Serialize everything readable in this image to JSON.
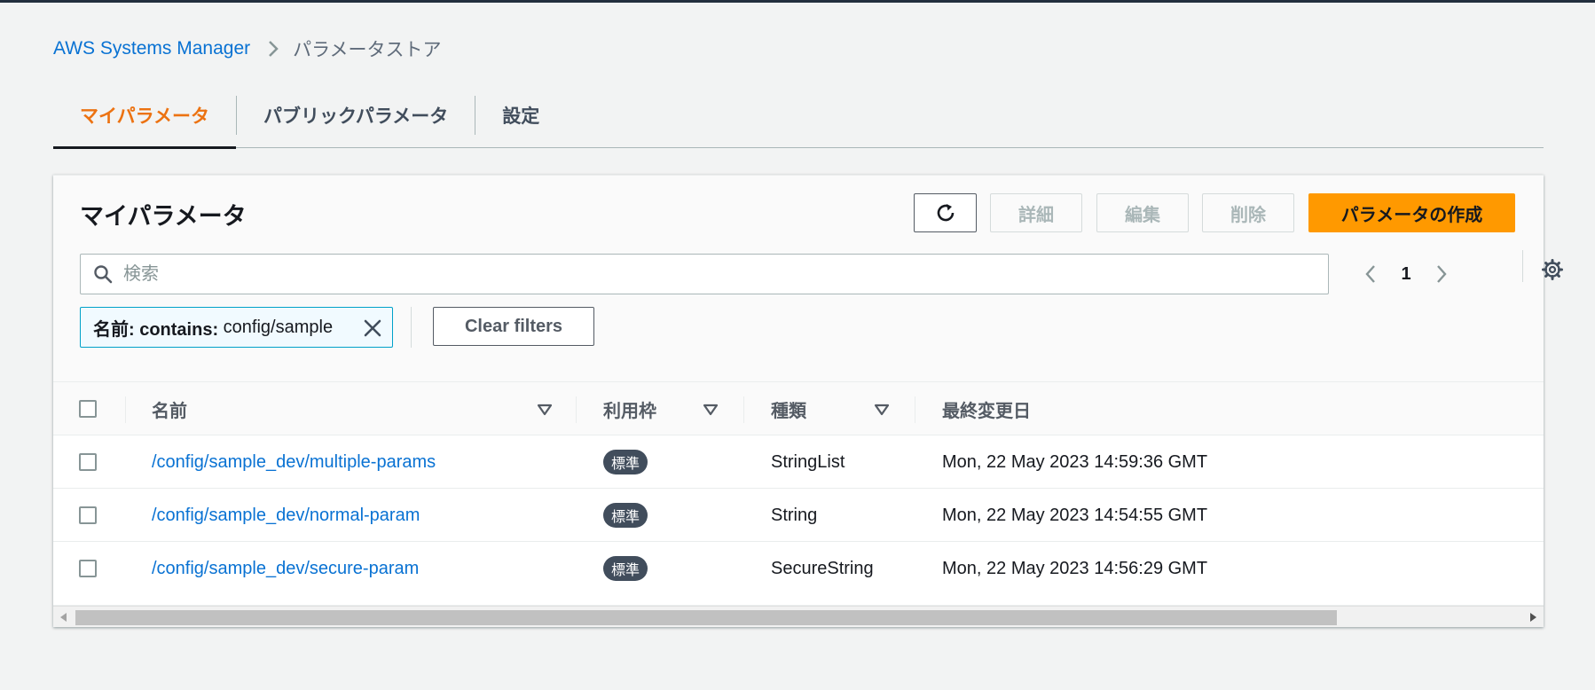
{
  "breadcrumb": {
    "root": "AWS Systems Manager",
    "current": "パラメータストア"
  },
  "tabs": [
    {
      "label": "マイパラメータ",
      "active": true
    },
    {
      "label": "パブリックパラメータ",
      "active": false
    },
    {
      "label": "設定",
      "active": false
    }
  ],
  "panel": {
    "title": "マイパラメータ",
    "buttons": {
      "details": "詳細",
      "edit": "編集",
      "delete": "削除",
      "create": "パラメータの作成"
    },
    "search": {
      "placeholder": "検索",
      "value": ""
    },
    "pagination": {
      "current_page": "1"
    },
    "filter": {
      "key": "名前: contains: ",
      "value": "config/sample"
    },
    "clear_filters": "Clear filters"
  },
  "table": {
    "columns": [
      "名前",
      "利用枠",
      "種類",
      "最終変更日"
    ],
    "rows": [
      {
        "name": "/config/sample_dev/multiple-params",
        "tier": "標準",
        "type": "StringList",
        "modified": "Mon, 22 May 2023 14:59:36 GMT"
      },
      {
        "name": "/config/sample_dev/normal-param",
        "tier": "標準",
        "type": "String",
        "modified": "Mon, 22 May 2023 14:54:55 GMT"
      },
      {
        "name": "/config/sample_dev/secure-param",
        "tier": "標準",
        "type": "SecureString",
        "modified": "Mon, 22 May 2023 14:56:29 GMT"
      }
    ]
  },
  "icons": {
    "breadcrumb_separator": "chevron-right-icon",
    "refresh": "refresh-icon",
    "search": "search-icon",
    "prev": "chevron-left-icon",
    "next": "chevron-right-icon",
    "settings": "gear-icon",
    "remove_filter": "close-icon",
    "sort": "caret-down-icon"
  },
  "colors": {
    "accent_orange": "#ec7211",
    "primary_button": "#ff9900",
    "link": "#0972d3",
    "badge": "#414d5c",
    "filter_border": "#00a1c9"
  }
}
